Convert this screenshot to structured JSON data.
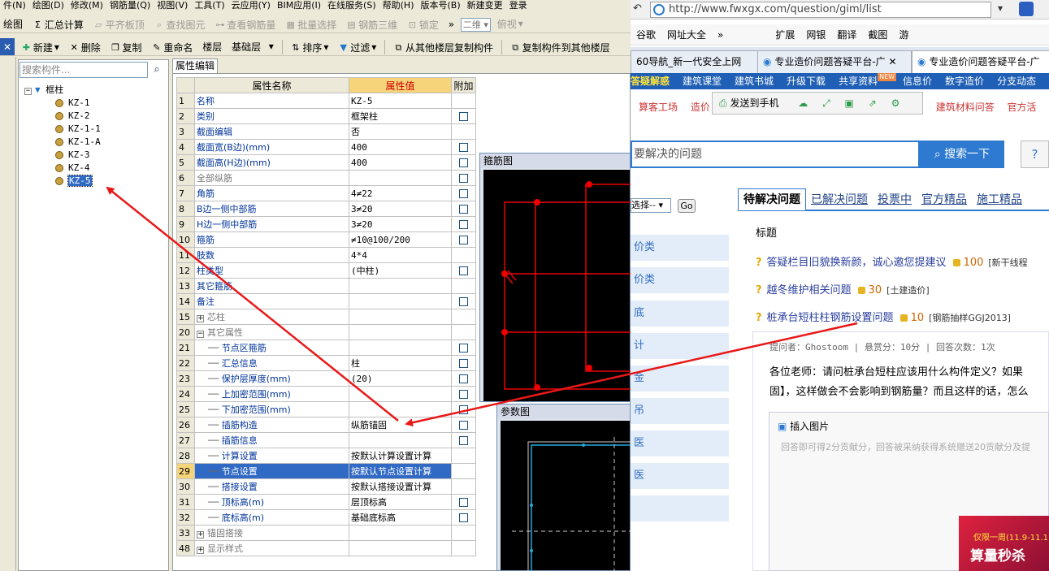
{
  "menubar": [
    "件(N)",
    "绘图(D)",
    "修改(M)",
    "钢筋量(Q)",
    "视图(V)",
    "工具(T)",
    "云应用(Y)",
    "BIM应用(I)",
    "在线服务(S)",
    "帮助(H)",
    "版本号(B)",
    "新建变更",
    "登录"
  ],
  "toolbar1": {
    "draw": "绘图",
    "sum": "汇总计算",
    "flat": "平齐板顶",
    "find": "查找图元",
    "viewrebar": "查看钢筋量",
    "batch": "批量选择",
    "rebar3d": "钢筋三维",
    "lock": "锁定",
    "more": "»",
    "view2d": "二维",
    "view_top": "俯视"
  },
  "toolbar2": {
    "new": "新建",
    "delete": "删除",
    "copy": "复制",
    "rename": "重命名",
    "floor_label": "楼层",
    "floor_value": "基础层",
    "sort": "排序",
    "filter": "过滤",
    "copy_from": "从其他楼层复制构件",
    "copy_to": "复制构件到其他楼层"
  },
  "search": {
    "placeholder": "搜索构件..."
  },
  "tree": {
    "root": "框柱",
    "items": [
      "KZ-1",
      "KZ-2",
      "KZ-1-1",
      "KZ-1-A",
      "KZ-3",
      "KZ-4",
      "KZ-5"
    ],
    "selected": "KZ-5"
  },
  "props": {
    "tab": "属性编辑",
    "headers": {
      "name": "属性名称",
      "value": "属性值",
      "extra": "附加"
    },
    "rows": [
      {
        "n": "1",
        "name": "名称",
        "value": "KZ-5",
        "cb": false,
        "gray": false
      },
      {
        "n": "2",
        "name": "类别",
        "value": "框架柱",
        "cb": true,
        "gray": false
      },
      {
        "n": "3",
        "name": "截面编辑",
        "value": "否",
        "cb": false,
        "gray": false
      },
      {
        "n": "4",
        "name": "截面宽(B边)(mm)",
        "value": "400",
        "cb": true,
        "gray": false
      },
      {
        "n": "5",
        "name": "截面高(H边)(mm)",
        "value": "400",
        "cb": true,
        "gray": false
      },
      {
        "n": "6",
        "name": "全部纵筋",
        "value": "",
        "cb": true,
        "gray": true
      },
      {
        "n": "7",
        "name": "角筋",
        "value": "4≠22",
        "cb": true,
        "gray": false
      },
      {
        "n": "8",
        "name": "B边一侧中部筋",
        "value": "3≠20",
        "cb": true,
        "gray": false
      },
      {
        "n": "9",
        "name": "H边一侧中部筋",
        "value": "3≠20",
        "cb": true,
        "gray": false
      },
      {
        "n": "10",
        "name": "箍筋",
        "value": "≠10@100/200",
        "cb": true,
        "gray": false
      },
      {
        "n": "11",
        "name": "肢数",
        "value": "4*4",
        "cb": false,
        "gray": false
      },
      {
        "n": "12",
        "name": "柱类型",
        "value": "(中柱)",
        "cb": true,
        "gray": false
      },
      {
        "n": "13",
        "name": "其它箍筋",
        "value": "",
        "cb": false,
        "gray": false
      },
      {
        "n": "14",
        "name": "备注",
        "value": "",
        "cb": true,
        "gray": false
      },
      {
        "n": "15",
        "name": "芯柱",
        "value": "",
        "cb": false,
        "gray": true,
        "exp": "+"
      },
      {
        "n": "20",
        "name": "其它属性",
        "value": "",
        "cb": false,
        "gray": true,
        "exp": "−"
      },
      {
        "n": "21",
        "name": "节点区箍筋",
        "value": "",
        "cb": true,
        "gray": false,
        "indent": true
      },
      {
        "n": "22",
        "name": "汇总信息",
        "value": "柱",
        "cb": true,
        "gray": false,
        "indent": true
      },
      {
        "n": "23",
        "name": "保护层厚度(mm)",
        "value": "(20)",
        "cb": true,
        "gray": false,
        "indent": true
      },
      {
        "n": "24",
        "name": "上加密范围(mm)",
        "value": "",
        "cb": true,
        "gray": false,
        "indent": true
      },
      {
        "n": "25",
        "name": "下加密范围(mm)",
        "value": "",
        "cb": true,
        "gray": false,
        "indent": true
      },
      {
        "n": "26",
        "name": "插筋构造",
        "value": "纵筋锚固",
        "cb": true,
        "gray": false,
        "indent": true
      },
      {
        "n": "27",
        "name": "插筋信息",
        "value": "",
        "cb": true,
        "gray": false,
        "indent": true
      },
      {
        "n": "28",
        "name": "计算设置",
        "value": "按默认计算设置计算",
        "cb": false,
        "gray": false,
        "indent": true
      },
      {
        "n": "29",
        "name": "节点设置",
        "value": "按默认节点设置计算",
        "cb": false,
        "gray": false,
        "indent": true,
        "hl": true
      },
      {
        "n": "30",
        "name": "搭接设置",
        "value": "按默认搭接设置计算",
        "cb": false,
        "gray": false,
        "indent": true
      },
      {
        "n": "31",
        "name": "顶标高(m)",
        "value": "层顶标高",
        "cb": true,
        "gray": false,
        "indent": true
      },
      {
        "n": "32",
        "name": "底标高(m)",
        "value": "基础底标高",
        "cb": true,
        "gray": false,
        "indent": true
      },
      {
        "n": "33",
        "name": "锚固搭接",
        "value": "",
        "cb": false,
        "gray": true,
        "exp": "+"
      },
      {
        "n": "48",
        "name": "显示样式",
        "value": "",
        "cb": false,
        "gray": true,
        "exp": "+"
      }
    ]
  },
  "windows": {
    "stirrup": "箍筋图",
    "params": "参数图"
  },
  "browser": {
    "url": "http://www.fwxgx.com/question/giml/list",
    "bookmarks": [
      "谷歌",
      "网址大全",
      "»",
      "扩展",
      "网银",
      "翻译",
      "截图",
      "游"
    ],
    "tabs": [
      "60导航_新一代安全上网",
      "专业造价问题答疑平台-广",
      "专业造价问题答疑平台-广"
    ],
    "nav1": [
      "答疑解惑",
      "建筑课堂",
      "建筑书城",
      "升级下载",
      "共享资料",
      "信息价",
      "数字造价",
      "分支动态"
    ],
    "nav1_badge": "NEW",
    "nav2": [
      "算客工场",
      "造价",
      "建筑材料问答",
      "官方活"
    ],
    "floatbar": "发送到手机",
    "search_placeholder": "要解决的问题",
    "search_btn": "搜索一下",
    "help_btn": "?",
    "side_select": "选择--",
    "go": "Go",
    "side_items": [
      "价类",
      "价类",
      "底",
      "计",
      "金",
      "吊",
      "医",
      "医",
      ""
    ],
    "qtabs": [
      "待解决问题",
      "已解决问题",
      "投票中",
      "官方精品",
      "施工精品"
    ],
    "list_head": "标题",
    "questions": [
      {
        "title": "答疑栏目旧貌换新颜，诚心邀您提建议",
        "pts": "100",
        "cat": "[新干线程"
      },
      {
        "title": "越冬维护相关问题",
        "pts": "30",
        "cat": "[土建造价]"
      },
      {
        "title": "桩承台短柱柱钢筋设置问题",
        "pts": "10",
        "cat": "[钢筋抽样GGJ2013]"
      }
    ],
    "meta": "提问者：Ghostoom  |  悬赏分：10分  |  回答次数：1次",
    "body1": "各位老师：请问桩承台短柱应该用什么构件定义？如果",
    "body2": "固】，这样做会不会影响到钢筋量？而且这样的话，怎么",
    "insert_img": "插入图片",
    "answer_hint": "回答即可得2分贡献分，回答被采纳获得系统赠送20贡献分及提",
    "promo1": "仅限一周(11.9-11.1",
    "promo2": "算量秒杀"
  }
}
